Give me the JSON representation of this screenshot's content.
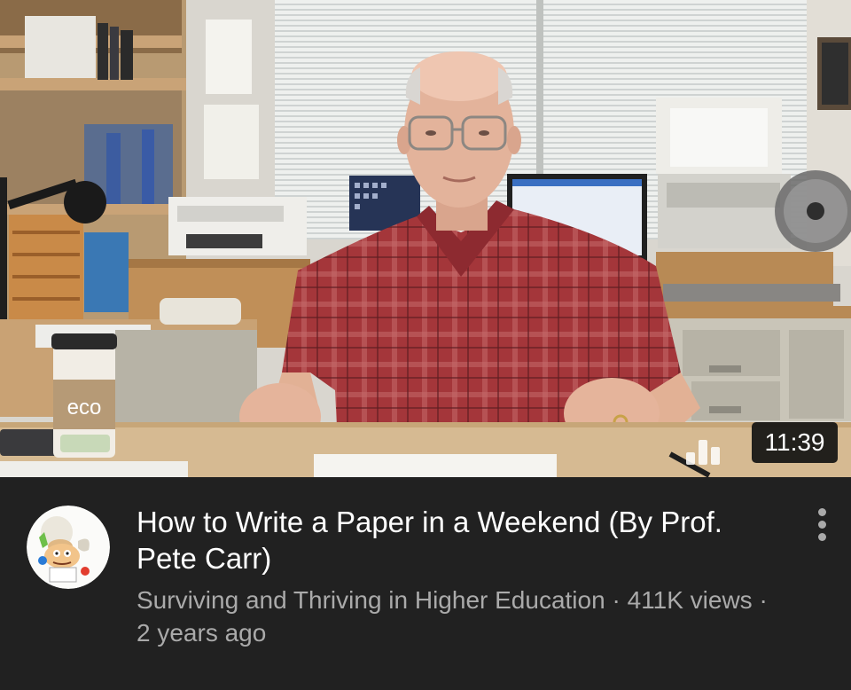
{
  "video": {
    "duration": "11:39",
    "title": "How to Write a Paper in a Weekend (By Prof. Pete Carr)",
    "channel": "Surviving and Thriving in Higher Education",
    "separator": " · ",
    "views": "411K views",
    "age": "2 years ago"
  },
  "thumbnail": {
    "cup_label": "eco"
  },
  "icons": {
    "menu": "more-vert-icon",
    "avatar": "channel-avatar-icon"
  },
  "colors": {
    "background": "#212121",
    "title": "#ffffff",
    "meta": "#aaaaaa",
    "shirt": "#a4363a"
  }
}
